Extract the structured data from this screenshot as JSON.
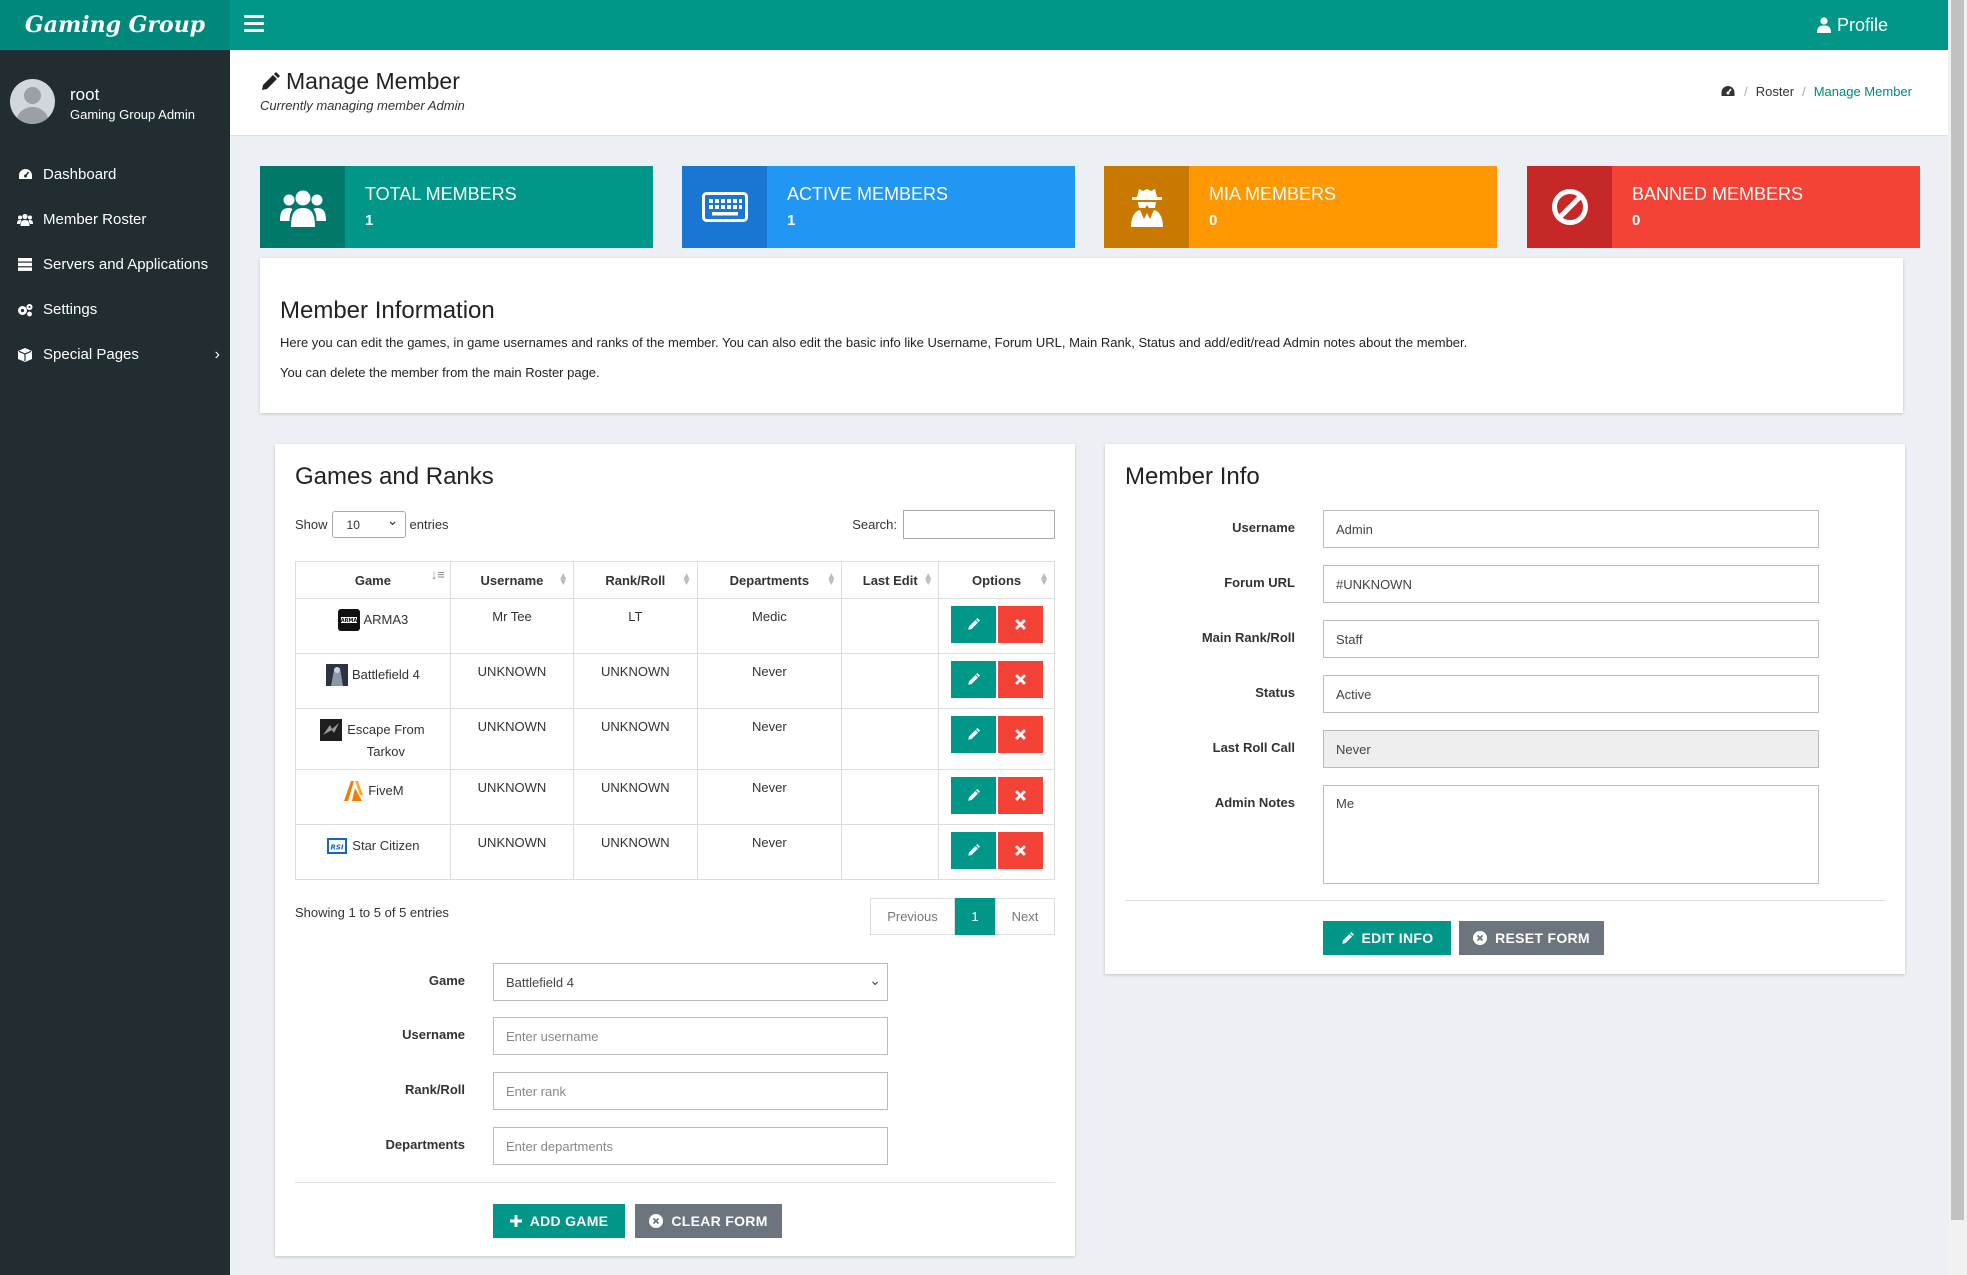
{
  "app": {
    "logo": "Gaming Group",
    "profile_label": "Profile"
  },
  "user": {
    "name": "root",
    "role": "Gaming Group Admin"
  },
  "sidebar": {
    "items": [
      {
        "label": "Dashboard",
        "icon": "dashboard-icon"
      },
      {
        "label": "Member Roster",
        "icon": "users-icon"
      },
      {
        "label": "Servers and Applications",
        "icon": "server-icon"
      },
      {
        "label": "Settings",
        "icon": "gear-icon"
      },
      {
        "label": "Special Pages",
        "icon": "cube-icon"
      }
    ]
  },
  "header": {
    "title": "Manage Member",
    "subtitle": "Currently managing member Admin",
    "breadcrumb": [
      "Roster",
      "Manage Member"
    ]
  },
  "stats": [
    {
      "title": "TOTAL MEMBERS",
      "value": "1",
      "icon": "users-icon",
      "color": "#009688",
      "icon_bg": "#00796b"
    },
    {
      "title": "ACTIVE MEMBERS",
      "value": "1",
      "icon": "keyboard-icon",
      "color": "#2196f3",
      "icon_bg": "#1976d2"
    },
    {
      "title": "MIA MEMBERS",
      "value": "0",
      "icon": "user-secret-icon",
      "color": "#ff9800",
      "icon_bg": "#c97800"
    },
    {
      "title": "BANNED MEMBERS",
      "value": "0",
      "icon": "ban-icon",
      "color": "#f44336",
      "icon_bg": "#c62828"
    }
  ],
  "member_information": {
    "title": "Member Information",
    "para1": "Here you can edit the games, in game usernames and ranks of the member. You can also edit the basic info like Username, Forum URL, Main Rank, Status and add/edit/read Admin notes about the member.",
    "para2": "You can delete the member from the main Roster page."
  },
  "games": {
    "title": "Games and Ranks",
    "show_label": "Show",
    "show_value": "10",
    "entries_label": "entries",
    "search_label": "Search:",
    "columns": [
      "Game",
      "Username",
      "Rank/Roll",
      "Departments",
      "Last Edit",
      "Options"
    ],
    "rows": [
      {
        "game": "ARMA3",
        "username": "Mr Tee",
        "rank": "LT",
        "departments": "Medic",
        "last_edit": ""
      },
      {
        "game": "Battlefield 4",
        "username": "UNKNOWN",
        "rank": "UNKNOWN",
        "departments": "Never",
        "last_edit": ""
      },
      {
        "game": "Escape From Tarkov",
        "username": "UNKNOWN",
        "rank": "UNKNOWN",
        "departments": "Never",
        "last_edit": ""
      },
      {
        "game": "FiveM",
        "username": "UNKNOWN",
        "rank": "UNKNOWN",
        "departments": "Never",
        "last_edit": ""
      },
      {
        "game": "Star Citizen",
        "username": "UNKNOWN",
        "rank": "UNKNOWN",
        "departments": "Never",
        "last_edit": ""
      }
    ],
    "showing": "Showing 1 to 5 of 5 entries",
    "pager": {
      "previous": "Previous",
      "current": "1",
      "next": "Next"
    },
    "form": {
      "game_label": "Game",
      "game_value": "Battlefield 4",
      "username_label": "Username",
      "username_placeholder": "Enter username",
      "rank_label": "Rank/Roll",
      "rank_placeholder": "Enter rank",
      "departments_label": "Departments",
      "departments_placeholder": "Enter departments",
      "add_button": "ADD GAME",
      "clear_button": "CLEAR FORM"
    }
  },
  "member_info": {
    "title": "Member Info",
    "fields": [
      {
        "label": "Username",
        "value": "Admin"
      },
      {
        "label": "Forum URL",
        "value": "#UNKNOWN"
      },
      {
        "label": "Main Rank/Roll",
        "value": "Staff"
      },
      {
        "label": "Status",
        "value": "Active"
      },
      {
        "label": "Last Roll Call",
        "value": "Never"
      },
      {
        "label": "Admin Notes",
        "value": "Me"
      }
    ],
    "edit_button": "EDIT INFO",
    "reset_button": "RESET FORM"
  }
}
